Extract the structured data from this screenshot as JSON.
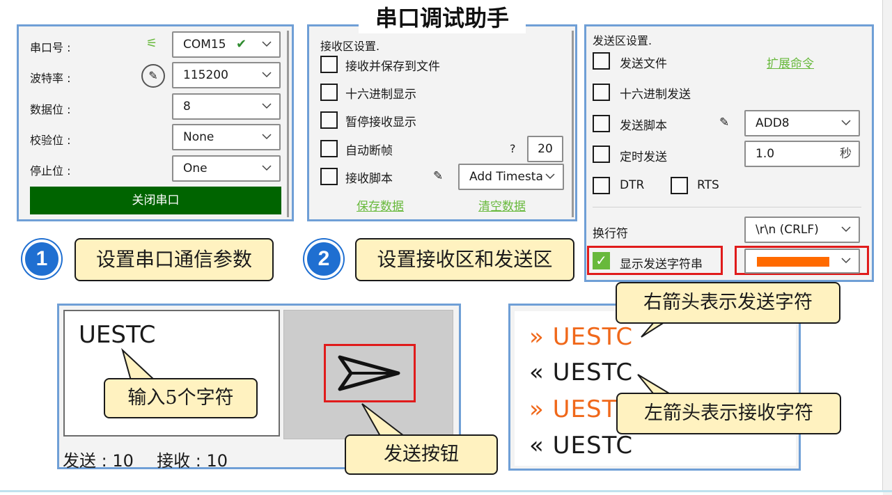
{
  "title": "串口调试助手",
  "serial": {
    "port_label": "串口号 :",
    "port_value": "COM15",
    "baud_label": "波特率 :",
    "baud_value": "115200",
    "data_label": "数据位 :",
    "data_value": "8",
    "parity_label": "校验位 :",
    "parity_value": "None",
    "stop_label": "停止位 :",
    "stop_value": "One",
    "close_button": "关闭串口",
    "button_color": "#006400"
  },
  "receive": {
    "title": "接收区设置.",
    "options": [
      {
        "label": "接收并保存到文件",
        "checked": false
      },
      {
        "label": "十六进制显示",
        "checked": false
      },
      {
        "label": "暂停接收显示",
        "checked": false
      },
      {
        "label": "自动断帧",
        "checked": false
      },
      {
        "label": "接收脚本",
        "checked": false
      }
    ],
    "help_mark": "?",
    "frame_value": "20",
    "script_value": "Add Timesta",
    "save_link": "保存数据",
    "clear_link": "清空数据"
  },
  "send": {
    "title": "发送区设置.",
    "options": [
      {
        "label": "发送文件",
        "checked": false
      },
      {
        "label": "十六进制发送",
        "checked": false
      },
      {
        "label": "发送脚本",
        "checked": false
      },
      {
        "label": "定时发送",
        "checked": false
      },
      {
        "label": "DTR",
        "checked": false
      },
      {
        "label": "RTS",
        "checked": false
      }
    ],
    "extend_link": "扩展命令",
    "script_value": "ADD8",
    "timer_value": "1.0",
    "timer_unit": "秒",
    "newline_label": "换行符",
    "newline_value": "\\r\\n (CRLF)",
    "show_string_label": "显示发送字符串",
    "show_string_checked": true,
    "color_value": "#ff6a00"
  },
  "callouts": {
    "step1_num": "1",
    "step1_text": "设置串口通信参数",
    "step2_num": "2",
    "step2_text": "设置接收区和发送区",
    "input_hint": "输入5个字符",
    "send_hint": "发送按钮",
    "right_arrow_hint": "右箭头表示发送字符",
    "left_arrow_hint": "左箭头表示接收字符"
  },
  "input_area": {
    "text": "UESTC"
  },
  "status": {
    "sent_label": "发送 : ",
    "sent_count": "10",
    "recv_label": "接收 : ",
    "recv_count": "10"
  },
  "log": [
    {
      "arrow": "»",
      "text": "UESTC",
      "dir": "sent"
    },
    {
      "arrow": "«",
      "text": "UESTC",
      "dir": "recv"
    },
    {
      "arrow": "»",
      "text": "UEST",
      "dir": "sent"
    },
    {
      "arrow": "«",
      "text": "UESTC",
      "dir": "recv"
    }
  ]
}
